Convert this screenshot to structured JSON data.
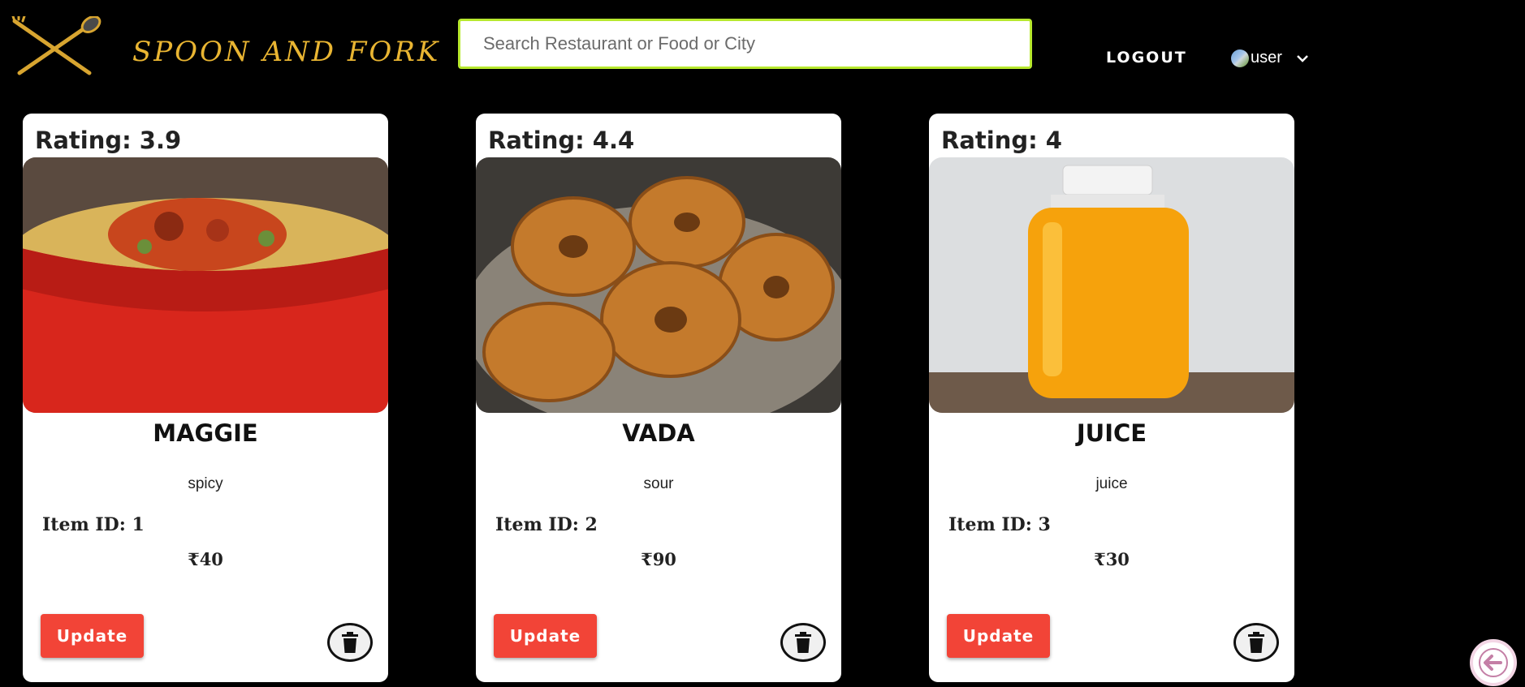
{
  "header": {
    "brand": "SPOON AND FORK",
    "search_placeholder": "Search Restaurant or Food or City",
    "logout_label": "LOGOUT",
    "user_label": "user",
    "logo_icon": "spoon-fork-logo-icon",
    "chevron_icon": "chevron-down-icon"
  },
  "colors": {
    "background": "#000000",
    "brand_gold": "#e9b532",
    "search_border": "#b7e82e",
    "update_button": "#f24437",
    "card": "#ffffff"
  },
  "cards": [
    {
      "rating": "Rating: 3.9",
      "name": "MAGGIE",
      "description": "spicy",
      "item_id": "Item ID: 1",
      "price": "₹40",
      "image": "noodles-in-red-bowl",
      "update_label": "Update"
    },
    {
      "rating": "Rating: 4.4",
      "name": "VADA",
      "description": "sour",
      "item_id": "Item ID: 2",
      "price": "₹90",
      "image": "fried-vada-in-bowl",
      "update_label": "Update"
    },
    {
      "rating": "Rating: 4",
      "name": "JUICE",
      "description": "juice",
      "item_id": "Item ID: 3",
      "price": "₹30",
      "image": "orange-juice-bottle",
      "update_label": "Update"
    }
  ],
  "icons": {
    "delete": "trash-icon",
    "back": "back-arrow-icon"
  }
}
